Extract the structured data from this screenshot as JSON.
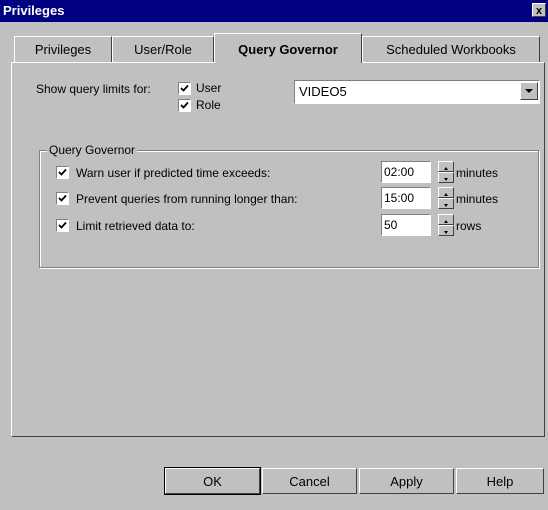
{
  "window": {
    "title": "Privileges",
    "close_glyph": "x"
  },
  "tabs": [
    {
      "label": "Privileges"
    },
    {
      "label": "User/Role"
    },
    {
      "label": "Query Governor"
    },
    {
      "label": "Scheduled Workbooks"
    }
  ],
  "show_limits": {
    "label": "Show query limits for:",
    "user_label": "User",
    "role_label": "Role",
    "user_checked": true,
    "role_checked": true,
    "selected": "VIDEO5"
  },
  "query_governor": {
    "title": "Query Governor",
    "warn": {
      "label": "Warn user if predicted time exceeds:",
      "value": "02:00",
      "unit": "minutes",
      "checked": true
    },
    "prevent": {
      "label": "Prevent queries from running longer than:",
      "value": "15:00",
      "unit": "minutes",
      "checked": true
    },
    "limit": {
      "label": "Limit retrieved data to:",
      "value": "50",
      "unit": "rows",
      "checked": true
    }
  },
  "buttons": {
    "ok": "OK",
    "cancel": "Cancel",
    "apply": "Apply",
    "help": "Help"
  }
}
